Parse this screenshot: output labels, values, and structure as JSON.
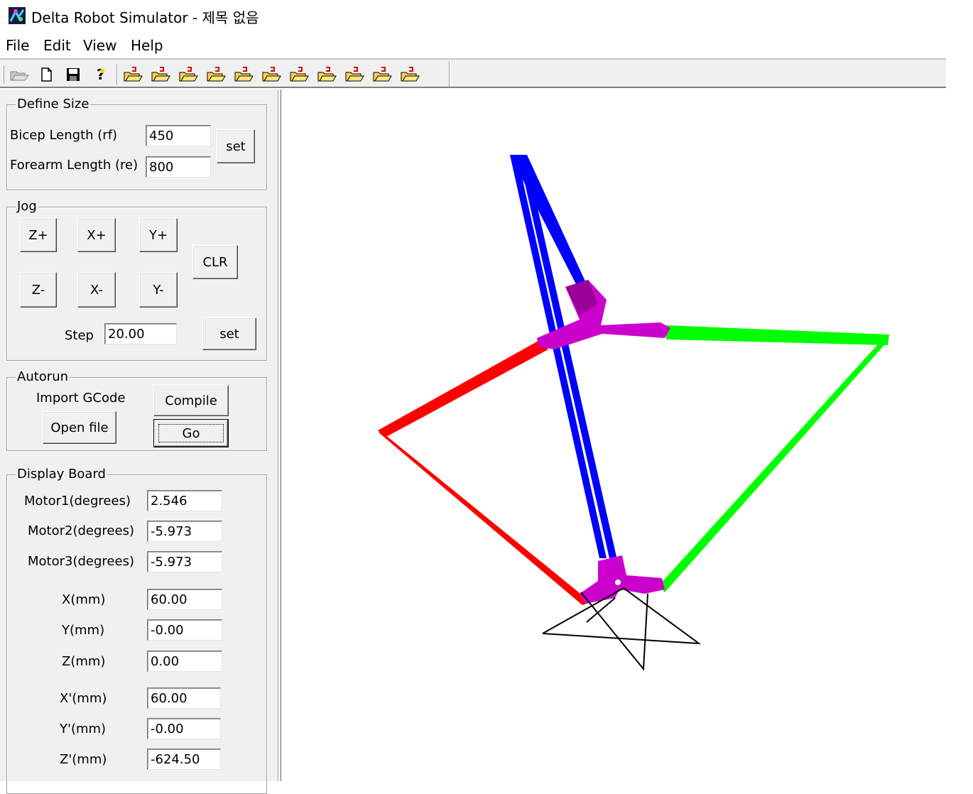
{
  "window": {
    "title": "Delta Robot Simulator - 제목 없음",
    "icon": "app-icon"
  },
  "menu": {
    "items": [
      "File",
      "Edit",
      "View",
      "Help"
    ]
  },
  "toolbar": {
    "buttons": [
      {
        "name": "open-folder-icon"
      },
      {
        "name": "new-document-icon"
      },
      {
        "name": "save-icon"
      },
      {
        "name": "help-icon"
      },
      {
        "name": "preset-open-icon-1"
      },
      {
        "name": "preset-open-icon-2"
      },
      {
        "name": "preset-open-icon-3"
      },
      {
        "name": "preset-open-icon-4"
      },
      {
        "name": "preset-open-icon-5"
      },
      {
        "name": "preset-open-icon-6"
      },
      {
        "name": "preset-open-icon-7"
      },
      {
        "name": "preset-open-icon-8"
      },
      {
        "name": "preset-open-icon-9"
      },
      {
        "name": "preset-open-icon-10"
      },
      {
        "name": "preset-open-icon-11"
      }
    ]
  },
  "define_size": {
    "legend": "Define Size",
    "bicep_label": "Bicep Length (rf)",
    "bicep_value": "450",
    "forearm_label": "Forearm Length (re)",
    "forearm_value": "800",
    "set_label": "set"
  },
  "jog": {
    "legend": "Jog",
    "z_plus": "Z+",
    "x_plus": "X+",
    "y_plus": "Y+",
    "z_minus": "Z-",
    "x_minus": "X-",
    "y_minus": "Y-",
    "clr": "CLR",
    "step_label": "Step",
    "step_value": "20.00",
    "set_label": "set"
  },
  "autorun": {
    "legend": "Autorun",
    "import_label": "Import GCode",
    "open_file_label": "Open file",
    "compile_label": "Compile",
    "go_label": "Go"
  },
  "display": {
    "legend": "Display Board",
    "motor1_label": "Motor1(degrees)",
    "motor1_value": "2.546",
    "motor2_label": "Motor2(degrees)",
    "motor2_value": "-5.973",
    "motor3_label": "Motor3(degrees)",
    "motor3_value": "-5.973",
    "x_label": "X(mm)",
    "x_value": "60.00",
    "y_label": "Y(mm)",
    "y_value": "-0.00",
    "z_label": "Z(mm)",
    "z_value": "0.00",
    "xp_label": "X'(mm)",
    "xp_value": "60.00",
    "yp_label": "Y'(mm)",
    "yp_value": "-0.00",
    "zp_label": "Z'(mm)",
    "zp_value": "-624.50"
  },
  "viewport": {
    "arm_colors": {
      "arm1": "#0000ff",
      "arm2": "#ff0000",
      "arm3": "#00ff00"
    },
    "platform_color": "#cc00cc",
    "frame_color": "#000000"
  }
}
